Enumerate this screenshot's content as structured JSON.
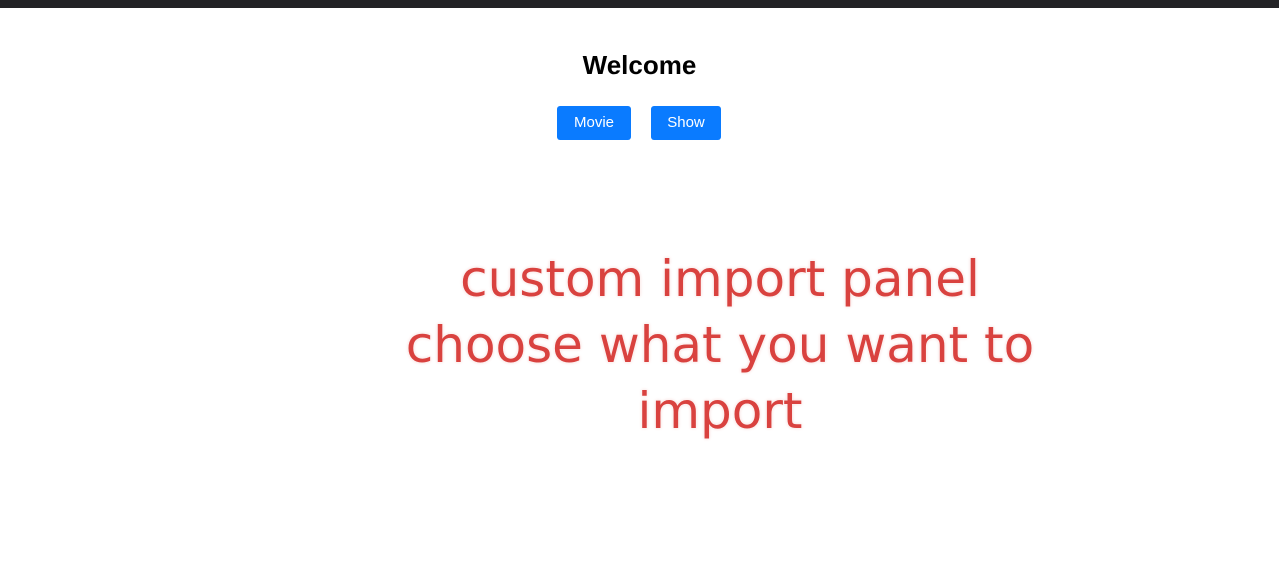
{
  "header": {
    "title": "Welcome"
  },
  "buttons": {
    "movie_label": "Movie",
    "show_label": "Show"
  },
  "annotation": {
    "lines": [
      "custom import panel",
      "choose what you want to",
      "import"
    ]
  },
  "colors": {
    "top_bar": "#232326",
    "button_bg": "#0a7bff",
    "annotation_text": "#d9423f"
  }
}
